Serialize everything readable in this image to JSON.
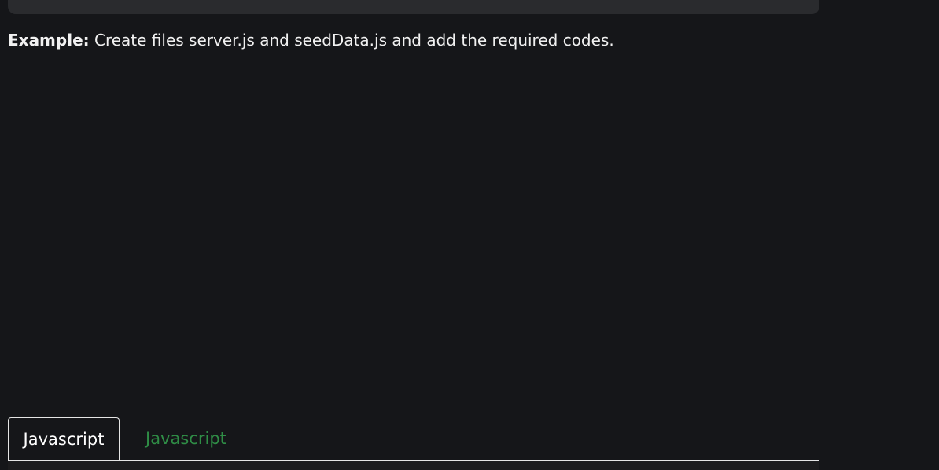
{
  "example": {
    "label": "Example:",
    "text": " Create files server.js and seedData.js and add the required codes."
  },
  "tabs": [
    {
      "label": "Javascript",
      "active": true
    },
    {
      "label": "Javascript",
      "active": false
    }
  ],
  "colors": {
    "background": "#151619",
    "active_tab_text": "#ffffff",
    "inactive_tab_text": "#2f8d46"
  }
}
